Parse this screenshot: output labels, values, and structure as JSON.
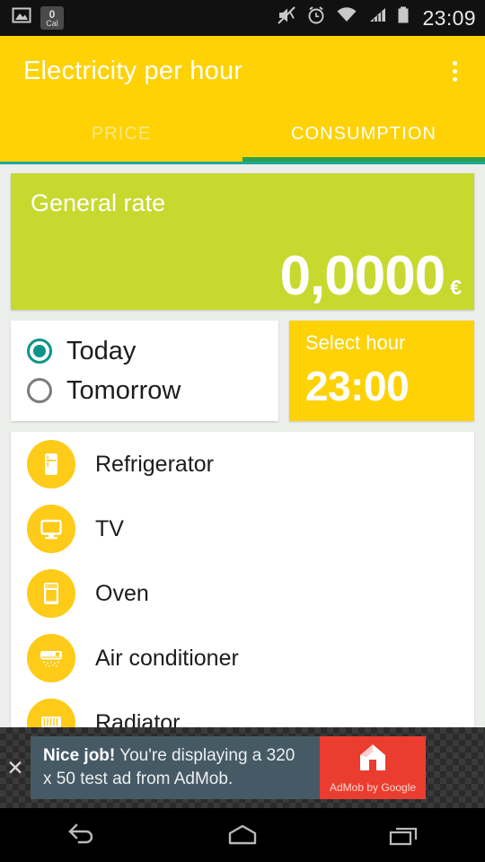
{
  "statusbar": {
    "gallery_icon": "gallery-icon",
    "calorie_badge": {
      "count": "0",
      "unit": "Cal"
    },
    "mute_icon": "volume-muted-icon",
    "alarm_icon": "alarm-clock-icon",
    "wifi_icon": "wifi-icon",
    "signal_icon": "cellular-signal-icon",
    "battery_icon": "battery-icon",
    "time": "23:09"
  },
  "appbar": {
    "title": "Electricity per hour",
    "overflow_label": "more-options",
    "color": "#fed204",
    "tabs": [
      {
        "label": "PRICE",
        "active": false
      },
      {
        "label": "CONSUMPTION",
        "active": true
      }
    ],
    "indicator_color": "#2e9e4e"
  },
  "rate_card": {
    "title": "General rate",
    "value": "0,0000",
    "unit": "€",
    "color": "#c7d92f"
  },
  "day_selector": {
    "options": [
      {
        "label": "Today",
        "selected": true
      },
      {
        "label": "Tomorrow",
        "selected": false
      }
    ],
    "accent_color": "#0d9486"
  },
  "hour_card": {
    "label": "Select hour",
    "value": "23:00",
    "color": "#fed204"
  },
  "appliances": [
    {
      "label": "Refrigerator",
      "icon": "refrigerator-icon"
    },
    {
      "label": "TV",
      "icon": "television-icon"
    },
    {
      "label": "Oven",
      "icon": "oven-icon"
    },
    {
      "label": "Air conditioner",
      "icon": "air-conditioner-icon"
    },
    {
      "label": "Radiator",
      "icon": "radiator-icon"
    }
  ],
  "ad": {
    "headline": "Nice job!",
    "body": "You're displaying a 320 x 50 test ad from AdMob.",
    "logo_caption": "AdMob by Google",
    "close_label": "✕",
    "logo_color": "#ea3d2f"
  },
  "navbar": {
    "back": "back-icon",
    "home": "home-icon",
    "recents": "recents-icon"
  }
}
